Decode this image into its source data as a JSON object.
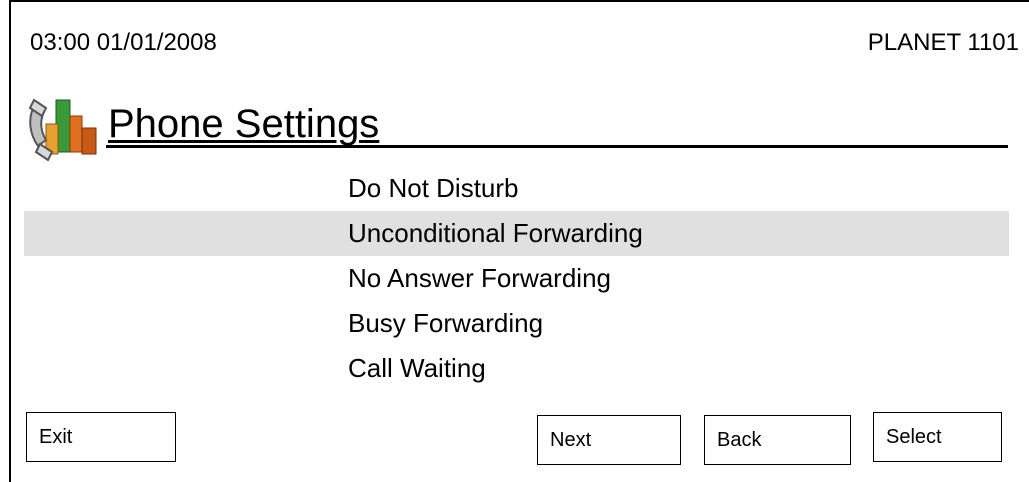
{
  "status": {
    "time_date": "03:00 01/01/2008",
    "model": "PLANET 1101"
  },
  "screen": {
    "title": "Phone Settings",
    "icon": "phone-settings-icon"
  },
  "menu": {
    "items": [
      {
        "label": "Do Not Disturb",
        "selected": false
      },
      {
        "label": "Unconditional Forwarding",
        "selected": true
      },
      {
        "label": "No Answer Forwarding",
        "selected": false
      },
      {
        "label": "Busy Forwarding",
        "selected": false
      },
      {
        "label": "Call Waiting",
        "selected": false
      }
    ]
  },
  "softkeys": {
    "exit": "Exit",
    "next": "Next",
    "back": "Back",
    "select": "Select"
  },
  "colors": {
    "selected_row": "#e0e0e0",
    "icon_green": "#3a9a3a",
    "icon_orange": "#e07020"
  }
}
